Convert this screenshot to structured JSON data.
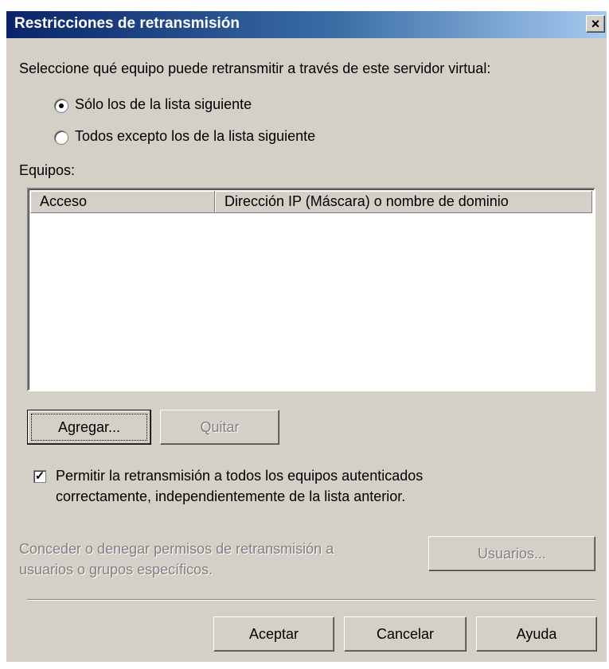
{
  "dialog": {
    "title": "Restricciones de retransmisión",
    "close_glyph": "×"
  },
  "intro_text": "Seleccione qué equipo puede retransmitir a través de este servidor virtual:",
  "radio_options": [
    {
      "label": "Sólo los de la lista siguiente",
      "selected": true
    },
    {
      "label": "Todos excepto los de la lista siguiente",
      "selected": false
    }
  ],
  "list": {
    "label": "Equipos:",
    "columns": [
      "Acceso",
      "Dirección IP (Máscara) o nombre de dominio"
    ],
    "rows": []
  },
  "buttons": {
    "add": "Agregar...",
    "remove": "Quitar",
    "users": "Usuarios...",
    "ok": "Aceptar",
    "cancel": "Cancelar",
    "help": "Ayuda"
  },
  "checkbox": {
    "checked": true,
    "line1": "Permitir la retransmisión a todos los equipos autenticados",
    "line2": "correctamente, independientemente de la lista anterior."
  },
  "grant_text": {
    "line1": "Conceder o denegar permisos de retransmisión a",
    "line2": "usuarios o grupos específicos."
  }
}
